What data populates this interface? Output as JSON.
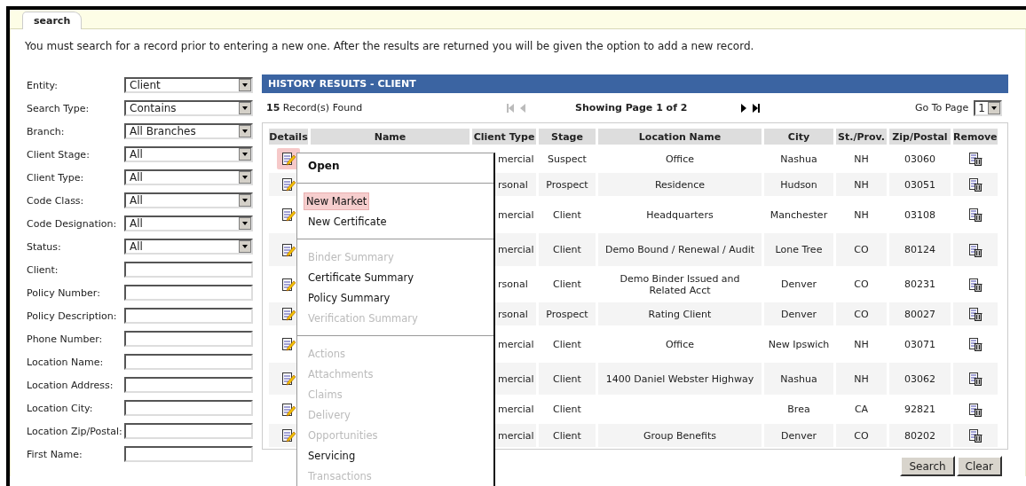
{
  "tab": {
    "label": "search",
    "selected": true
  },
  "instructions": "You must search for a record prior to entering a new one. After the results are returned you will be given the option to add a new record.",
  "form": {
    "fields": [
      {
        "label": "Entity:",
        "kind": "select",
        "value": "Client"
      },
      {
        "label": "Search Type:",
        "kind": "select",
        "value": "Contains"
      },
      {
        "label": "Branch:",
        "kind": "select",
        "value": "All Branches"
      },
      {
        "label": "Client Stage:",
        "kind": "select",
        "value": "All"
      },
      {
        "label": "Client Type:",
        "kind": "select",
        "value": "All"
      },
      {
        "label": "Code Class:",
        "kind": "select",
        "value": "All"
      },
      {
        "label": "Code Designation:",
        "kind": "select",
        "value": "All"
      },
      {
        "label": "Status:",
        "kind": "select",
        "value": "All"
      },
      {
        "label": "Client:",
        "kind": "text"
      },
      {
        "label": "Policy Number:",
        "kind": "text"
      },
      {
        "label": "Policy Description:",
        "kind": "text"
      },
      {
        "label": "Phone Number:",
        "kind": "text"
      },
      {
        "label": "Location Name:",
        "kind": "text"
      },
      {
        "label": "Location Address:",
        "kind": "text"
      },
      {
        "label": "Location City:",
        "kind": "text"
      },
      {
        "label": "Location Zip/Postal:",
        "kind": "text"
      },
      {
        "label": "First Name:",
        "kind": "text"
      }
    ]
  },
  "results": {
    "title": "HISTORY RESULTS - CLIENT",
    "record_count": "**15** Record(s) Found",
    "pager": [
      {
        "kind": "first",
        "disabled": true
      },
      {
        "kind": "prev",
        "disabled": true
      },
      {
        "kind": "status",
        "text": "Showing Page 1 of 2"
      },
      {
        "kind": "next",
        "disabled": false
      },
      {
        "kind": "last",
        "disabled": false
      }
    ],
    "goto_label": "Go To Page",
    "goto_value": "1",
    "columns": [
      "Details",
      "Name",
      "Client Type",
      "Stage",
      "Location Name",
      "City",
      "St./Prov.",
      "Zip/Postal",
      "Remove"
    ],
    "rows": [
      {
        "selected": true,
        "client_type": "mercial",
        "stage": "Suspect",
        "location_name": "Office",
        "city": "Nashua",
        "state": "NH",
        "zip": "03060"
      },
      {
        "selected": false,
        "client_type": "rsonal",
        "stage": "Prospect",
        "location_name": "Residence",
        "city": "Hudson",
        "state": "NH",
        "zip": "03051"
      },
      {
        "selected": false,
        "client_type": "mercial",
        "stage": "Client",
        "location_name": "Headquarters",
        "city": "Manchester",
        "state": "NH",
        "zip": "03108"
      },
      {
        "selected": false,
        "client_type": "mercial",
        "stage": "Client",
        "location_name": "Demo Bound / Renewal / Audit",
        "city": "Lone Tree",
        "state": "CO",
        "zip": "80124"
      },
      {
        "selected": false,
        "client_type": "rsonal",
        "stage": "Client",
        "location_name": "Demo Binder Issued and Related Acct",
        "city": "Denver",
        "state": "CO",
        "zip": "80231"
      },
      {
        "selected": false,
        "client_type": "rsonal",
        "stage": "Prospect",
        "location_name": "Rating Client",
        "city": "Denver",
        "state": "CO",
        "zip": "80027"
      },
      {
        "selected": false,
        "client_type": "mercial",
        "stage": "Client",
        "location_name": "Office",
        "city": "New Ipswich",
        "state": "NH",
        "zip": "03071"
      },
      {
        "selected": false,
        "client_type": "mercial",
        "stage": "Client",
        "location_name": "1400 Daniel Webster Highway",
        "city": "Nashua",
        "state": "NH",
        "zip": "03062"
      },
      {
        "selected": false,
        "client_type": "mercial",
        "stage": "Client",
        "city": "Brea",
        "state": "CA",
        "zip": "92821"
      },
      {
        "selected": false,
        "client_type": "mercial",
        "stage": "Client",
        "location_name": "Group Benefits",
        "city": "Denver",
        "state": "CO",
        "zip": "80202"
      }
    ],
    "buttons": [
      "Search",
      "Clear"
    ]
  },
  "menu": {
    "items": [
      {
        "kind": "default",
        "label": "Open",
        "disabled": false,
        "selected": false
      },
      {
        "kind": "separator"
      },
      {
        "kind": "item",
        "label": "New Market",
        "disabled": false,
        "selected": true
      },
      {
        "kind": "item",
        "label": "New Certificate",
        "disabled": false,
        "selected": false
      },
      {
        "kind": "separator"
      },
      {
        "kind": "item",
        "label": "Binder Summary",
        "disabled": true,
        "selected": false
      },
      {
        "kind": "item",
        "label": "Certificate Summary",
        "disabled": false,
        "selected": false
      },
      {
        "kind": "item",
        "label": "Policy Summary",
        "disabled": false,
        "selected": false
      },
      {
        "kind": "item",
        "label": "Verification Summary",
        "disabled": true,
        "selected": false
      },
      {
        "kind": "separator"
      },
      {
        "kind": "item",
        "label": "Actions",
        "disabled": true,
        "selected": false
      },
      {
        "kind": "item",
        "label": "Attachments",
        "disabled": true,
        "selected": false
      },
      {
        "kind": "item",
        "label": "Claims",
        "disabled": true,
        "selected": false
      },
      {
        "kind": "item",
        "label": "Delivery",
        "disabled": true,
        "selected": false
      },
      {
        "kind": "item",
        "label": "Opportunities",
        "disabled": true,
        "selected": false
      },
      {
        "kind": "item",
        "label": "Servicing",
        "disabled": false,
        "selected": false
      },
      {
        "kind": "item",
        "label": "Transactions",
        "disabled": true,
        "selected": false
      }
    ]
  }
}
